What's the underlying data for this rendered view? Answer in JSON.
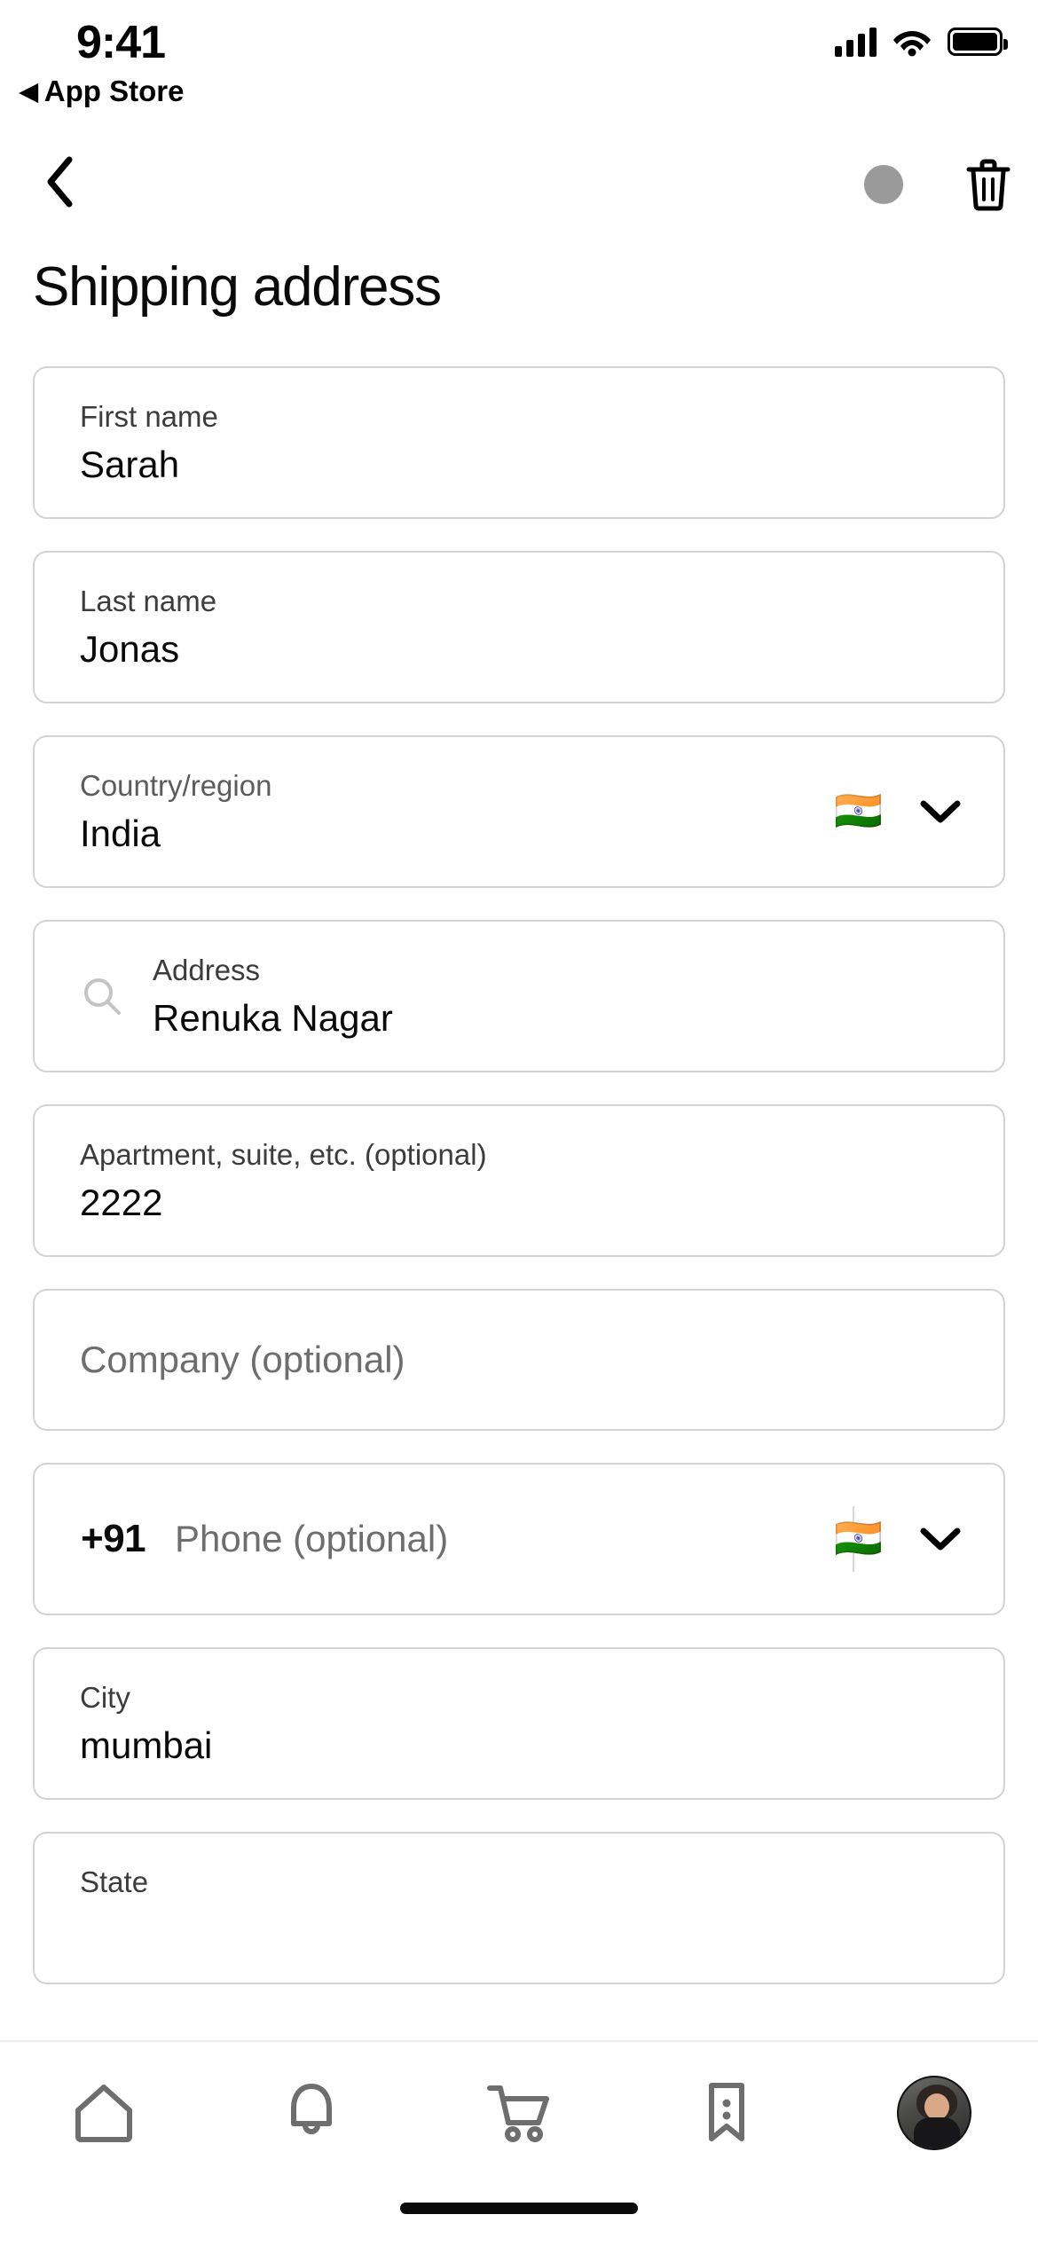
{
  "status_bar": {
    "time": "9:41",
    "back_app_label": "App Store",
    "back_triangle": "◀",
    "signal_icon": "cellular-signal-icon",
    "wifi_icon": "wifi-icon",
    "battery_icon": "battery-full-icon"
  },
  "nav_bar": {
    "back_icon": "chevron-left-icon",
    "loading_icon": "loading-spinner-dot",
    "delete_icon": "trash-icon"
  },
  "header": {
    "title": "Shipping address"
  },
  "form": {
    "fields": [
      {
        "name": "first-name",
        "label": "First name",
        "value": "Sarah",
        "placeholder": "First name"
      },
      {
        "name": "last-name",
        "label": "Last name",
        "value": "Jonas",
        "placeholder": "Last name"
      },
      {
        "name": "country-region",
        "label": "Country/region",
        "value": "India",
        "flag": "🇮🇳",
        "flag_name": "india-flag-icon",
        "chevron": "chevron-down-icon"
      },
      {
        "name": "address",
        "label": "Address",
        "value": "Renuka Nagar",
        "search_icon": "search-icon"
      },
      {
        "name": "apartment",
        "label": "Apartment, suite, etc. (optional)",
        "value": "2222"
      },
      {
        "name": "company",
        "label": "",
        "value": "",
        "placeholder": "Company (optional)"
      },
      {
        "name": "phone",
        "country_code": "+91",
        "placeholder": "Phone (optional)",
        "value": "",
        "flag": "🇮🇳",
        "flag_name": "india-flag-icon",
        "chevron": "chevron-down-icon"
      },
      {
        "name": "city",
        "label": "City",
        "value": "mumbai"
      },
      {
        "name": "state",
        "label": "State",
        "value": ""
      }
    ]
  },
  "tab_bar": {
    "items": [
      {
        "name": "home",
        "icon": "home-icon"
      },
      {
        "name": "notifications",
        "icon": "bell-icon"
      },
      {
        "name": "cart",
        "icon": "shopping-cart-icon"
      },
      {
        "name": "orders",
        "icon": "bookmark-icon"
      },
      {
        "name": "profile",
        "icon": "avatar-image"
      }
    ]
  },
  "colors": {
    "border": "#d3d3d3",
    "label": "#3c3c3c",
    "value": "#0a0a0a",
    "placeholder": "#6e6e6e",
    "tab_icon": "#6e6e6e",
    "spinner": "#9a9a9a"
  }
}
